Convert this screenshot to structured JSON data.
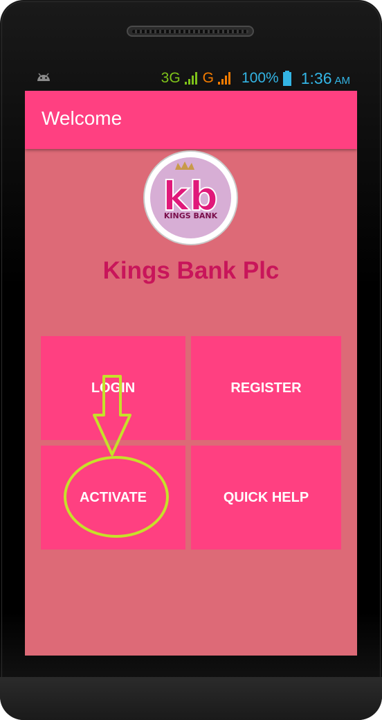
{
  "status_bar": {
    "network_primary": "3G",
    "network_secondary": "G",
    "battery": "100%",
    "time": "1:36",
    "ampm": "AM",
    "icons": [
      "android-icon",
      "signal-icon",
      "signal-icon",
      "battery-icon"
    ]
  },
  "app_bar": {
    "title": "Welcome"
  },
  "logo": {
    "letters": "kb",
    "caption": "KINGS BANK"
  },
  "bank_name": "Kings Bank Plc",
  "menu": {
    "login": "LOGIN",
    "register": "REGISTER",
    "activate": "ACTIVATE",
    "quick_help": "QUICK HELP"
  },
  "colors": {
    "app_bar": "#ff4081",
    "screen_background": "#dd6a77",
    "bank_name": "#c8155a",
    "annotation": "#c6e12a"
  }
}
